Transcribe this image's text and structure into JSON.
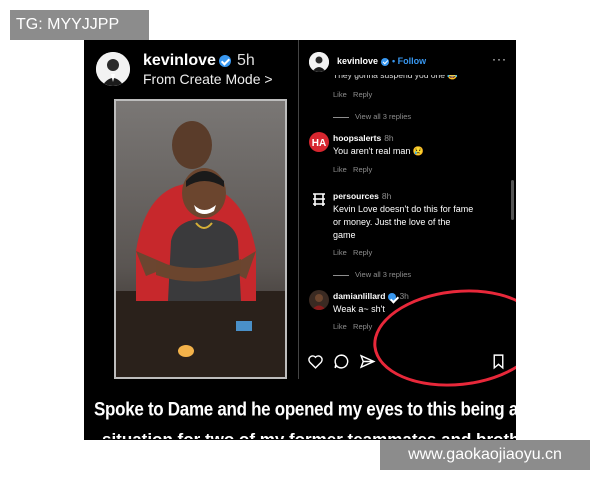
{
  "tg_label": "TG: MYYJJPP",
  "watermark": "www.gaokaojiaoyu.cn",
  "story": {
    "username": "kevinlove",
    "time": "5h",
    "mode": "From Create Mode >"
  },
  "caption": {
    "line1": "Spoke to Dame and he opened my eyes to this being a real",
    "line2": "situation for two of my former teammates and brother"
  },
  "post": {
    "username": "kevinlove",
    "follow_label": "• Follow",
    "more_label": "···",
    "cut_text": "They gonna suspend you one 😂",
    "like_label": "Like",
    "reply_label": "Reply",
    "view_replies": "View all 3 replies",
    "comments": [
      {
        "user": "hoopsalerts",
        "verified": true,
        "time": "8h",
        "text": "You aren't real man 😢"
      },
      {
        "user": "persources",
        "verified": false,
        "time": "8h",
        "text_lines": [
          "Kevin Love doesn't do this for fame",
          "or money. Just the love of the",
          "game"
        ]
      },
      {
        "user": "damianlillard",
        "verified": true,
        "time": "3h",
        "text": "Weak a~  sh't"
      }
    ]
  },
  "colors": {
    "accent_blue": "#3897f0",
    "highlight_red": "#e8283a",
    "hoopsalerts_red": "#d7262f"
  },
  "icons": [
    "heart-icon",
    "comment-icon",
    "share-icon",
    "bookmark-icon",
    "verified-icon"
  ]
}
